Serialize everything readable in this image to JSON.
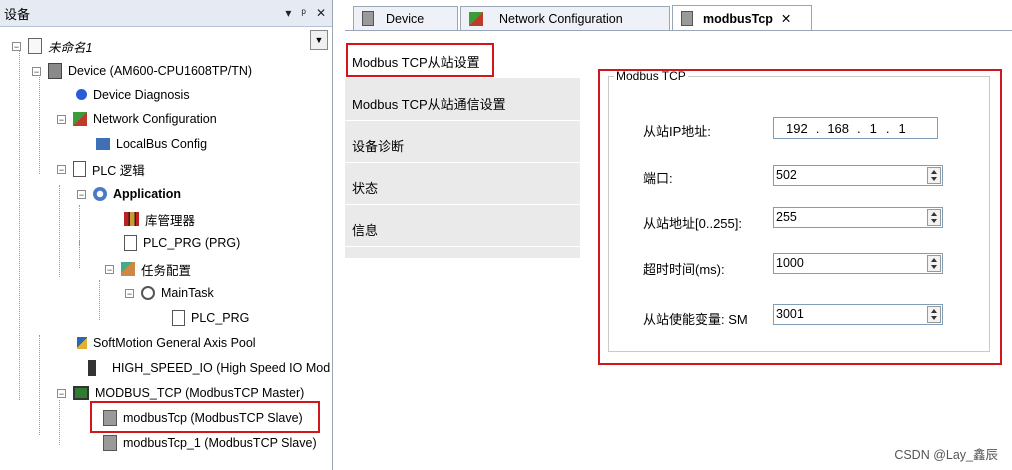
{
  "left_pane": {
    "title": "设备",
    "pin_label": "▾",
    "dock_label": "ᵖ",
    "close_label": "✕",
    "tree": [
      {
        "label": "未命名1"
      },
      {
        "label": "Device (AM600-CPU1608TP/TN)"
      },
      {
        "label": "Device Diagnosis"
      },
      {
        "label": "Network Configuration"
      },
      {
        "label": "LocalBus Config"
      },
      {
        "label": "PLC 逻辑"
      },
      {
        "label": "Application"
      },
      {
        "label": "库管理器"
      },
      {
        "label": "PLC_PRG (PRG)"
      },
      {
        "label": "任务配置"
      },
      {
        "label": "MainTask"
      },
      {
        "label": "PLC_PRG"
      },
      {
        "label": "SoftMotion General Axis Pool"
      },
      {
        "label": "HIGH_SPEED_IO (High Speed IO Mod"
      },
      {
        "label": "MODBUS_TCP (ModbusTCP Master)"
      },
      {
        "label": "modbusTcp (ModbusTCP Slave)"
      },
      {
        "label": "modbusTcp_1 (ModbusTCP Slave)"
      }
    ]
  },
  "tabs": [
    {
      "label": "Device"
    },
    {
      "label": "Network Configuration"
    },
    {
      "label": "modbusTcp"
    }
  ],
  "tab_close": "✕",
  "side_menu": [
    {
      "label": "Modbus TCP从站设置"
    },
    {
      "label": "Modbus TCP从站通信设置"
    },
    {
      "label": "设备诊断"
    },
    {
      "label": "状态"
    },
    {
      "label": "信息"
    }
  ],
  "settings": {
    "group_title": "Modbus TCP",
    "ip_label": "从站IP地址:",
    "ip": [
      "192",
      "168",
      "1",
      "1"
    ],
    "ip_sep": ".",
    "port_label": "端口:",
    "port_value": "502",
    "slave_addr_label": "从站地址[0..255]:",
    "slave_addr_value": "255",
    "timeout_label": "超时时间(ms):",
    "timeout_value": "1000",
    "enable_var_label": "从站使能变量: SM",
    "enable_var_value": "3001"
  },
  "watermark": "CSDN @Lay_鑫辰",
  "colors": {
    "highlight_box": "#d0171b",
    "accent": "#e6ebf3"
  }
}
